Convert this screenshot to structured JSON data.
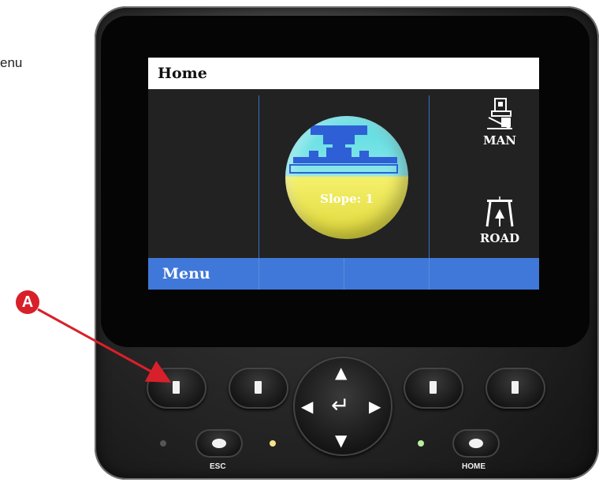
{
  "side_note": {
    "text": "enu"
  },
  "screen": {
    "title": "Home",
    "gauge": {
      "label": "Slope:",
      "value": "1"
    },
    "mode_buttons": [
      {
        "label": "MAN",
        "icon": "manual-paver-icon"
      },
      {
        "label": "ROAD",
        "icon": "road-icon"
      }
    ],
    "menu": {
      "label": "Menu"
    }
  },
  "keypad": {
    "esc_label": "ESC",
    "home_label": "HOME",
    "arrows": {
      "up": "▲",
      "down": "▼",
      "left": "◀",
      "right": "▶",
      "enter": "↵"
    }
  },
  "callout": {
    "label": "A"
  },
  "colors": {
    "screen_bg": "#222222",
    "menu_bar": "#3f78d8",
    "gauge_top": "#54dbe0",
    "gauge_bottom": "#e0d93c",
    "callout": "#d8202a",
    "led_off": "#555555",
    "led_yellow": "#f4e28a",
    "led_green": "#b8ef9a"
  }
}
